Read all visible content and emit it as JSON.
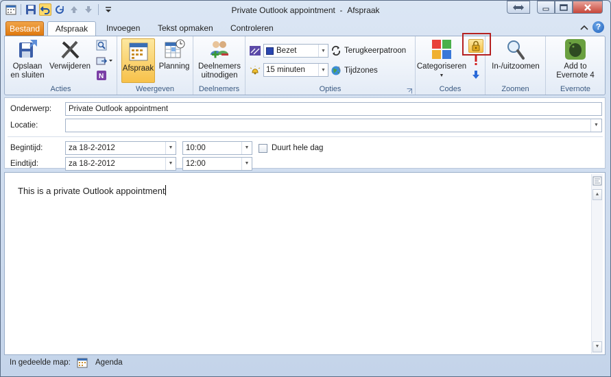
{
  "window": {
    "title": "Private Outlook appointment",
    "title_sep": "-",
    "title_type": "Afspraak"
  },
  "tabs": [
    {
      "label": "Bestand"
    },
    {
      "label": "Afspraak"
    },
    {
      "label": "Invoegen"
    },
    {
      "label": "Tekst opmaken"
    },
    {
      "label": "Controleren"
    }
  ],
  "ribbon": {
    "acties": {
      "label": "Acties",
      "save": "Opslaan\nen sluiten",
      "delete": "Verwijderen"
    },
    "weergeven": {
      "label": "Weergeven",
      "afspraak": "Afspraak",
      "planning": "Planning"
    },
    "deelnemers": {
      "label": "Deelnemers",
      "invite": "Deelnemers\nuitnodigen"
    },
    "opties": {
      "label": "Opties",
      "show_as": "Bezet",
      "reminder": "15 minuten",
      "recurrence": "Terugkeerpatroon",
      "timezones": "Tijdzones"
    },
    "codes": {
      "label": "Codes",
      "categorize": "Categoriseren"
    },
    "zoomen": {
      "label": "Zoomen",
      "zoom": "In-/uitzoomen"
    },
    "evernote": {
      "label": "Evernote",
      "add": "Add to\nEvernote 4"
    }
  },
  "form": {
    "subject_label": "Onderwerp:",
    "subject_value": "Private Outlook appointment",
    "location_label": "Locatie:",
    "location_value": "",
    "start_label": "Begintijd:",
    "start_date": "za 18-2-2012",
    "start_time": "10:00",
    "allday_label": "Duurt hele dag",
    "end_label": "Eindtijd:",
    "end_date": "za 18-2-2012",
    "end_time": "12:00"
  },
  "body_text": "This is a private Outlook appointment",
  "status": {
    "label": "In gedeelde map:",
    "folder": "Agenda"
  },
  "colors": {
    "file_tab": "#e07a10",
    "highlight": "#b52020",
    "group_label": "#3b5a82"
  }
}
